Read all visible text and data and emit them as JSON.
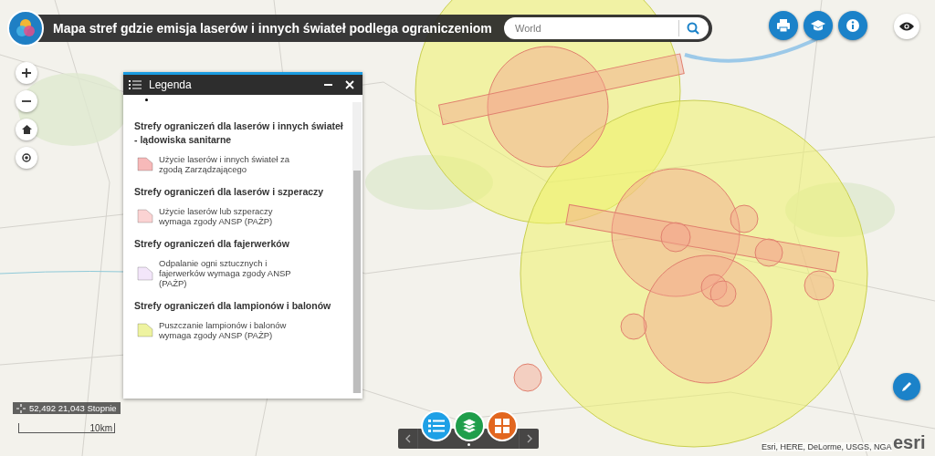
{
  "header": {
    "title": "Mapa stref gdzie emisja laserów i innych świateł podlega ograniczeniom",
    "search": {
      "placeholder": "World"
    }
  },
  "top_buttons": [
    {
      "kind": "print"
    },
    {
      "kind": "graduation"
    },
    {
      "kind": "info"
    }
  ],
  "map_controls": [
    {
      "kind": "zoom-in"
    },
    {
      "kind": "zoom-out"
    },
    {
      "kind": "home"
    },
    {
      "kind": "locate"
    }
  ],
  "legend": {
    "title": "Legenda",
    "sections": [
      {
        "heading": "Strefy ograniczeń dla laserów i innych świateł - lądowiska sanitarne",
        "items": [
          {
            "label": "Użycie laserów i innych świateł za zgodą Zarządzającego",
            "color": "#f7b9b9"
          }
        ]
      },
      {
        "heading": "Strefy ograniczeń dla laserów i szperaczy",
        "items": [
          {
            "label": "Użycie laserów lub szperaczy wymaga zgody ANSP (PAŻP)",
            "color": "#fbd3d3"
          }
        ]
      },
      {
        "heading": "Strefy ograniczeń dla fajerwerków",
        "items": [
          {
            "label": "Odpalanie ogni sztucznych i fajerwerków wymaga zgody ANSP (PAŻP)",
            "color": "#f3e6fa"
          }
        ]
      },
      {
        "heading": "Strefy ograniczeń dla lampionów i balonów",
        "items": [
          {
            "label": "Puszczanie lampionów i balonów wymaga zgody ANSP (PAŻP)",
            "color": "#eef3a0"
          }
        ]
      }
    ]
  },
  "coordinates": "52,492 21,043 Stopnie",
  "scale": "10km",
  "widget_bar": [
    {
      "kind": "legend"
    },
    {
      "kind": "layers"
    },
    {
      "kind": "basemap"
    }
  ],
  "attribution": "Esri, HERE, DeLorme, USGS, NGA",
  "logo": "esri"
}
